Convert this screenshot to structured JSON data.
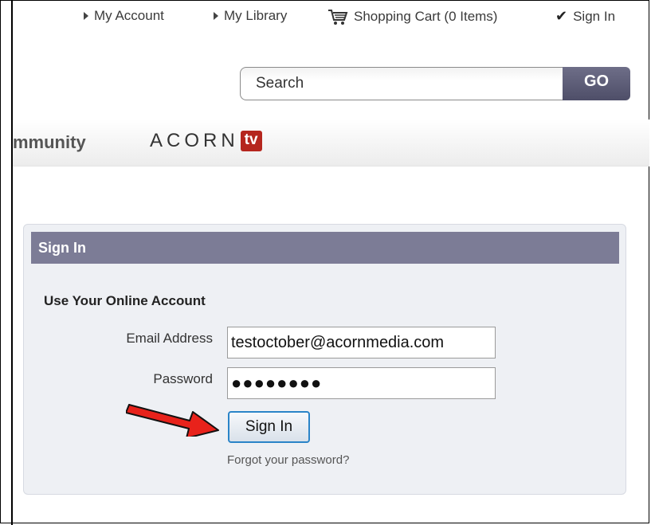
{
  "header": {
    "links": [
      {
        "label": "My Account",
        "icon": "triangle-bullet-icon"
      },
      {
        "label": "My Library",
        "icon": "triangle-bullet-icon"
      },
      {
        "label": "Shopping Cart (0 Items)",
        "icon": "shopping-cart-icon"
      },
      {
        "label": "Sign In",
        "icon": "check-icon"
      }
    ]
  },
  "search": {
    "placeholder": "Search",
    "go_label": "GO"
  },
  "nav": {
    "community_label": "mmunity",
    "logo_word": "ACORN",
    "logo_badge": "tv"
  },
  "signin_panel": {
    "title": "Sign In",
    "subtitle": "Use Your Online Account",
    "email_label": "Email Address",
    "email_value": "testoctober@acornmedia.com",
    "password_label": "Password",
    "password_value": "●●●●●●●●",
    "submit_label": "Sign In",
    "forgot_label": "Forgot your password?"
  },
  "colors": {
    "panel_header": "#7c7c96",
    "go_button": "#5b5b75",
    "tv_badge": "#b5261e",
    "arrow": "#e8221b",
    "button_border": "#2a84c8"
  }
}
